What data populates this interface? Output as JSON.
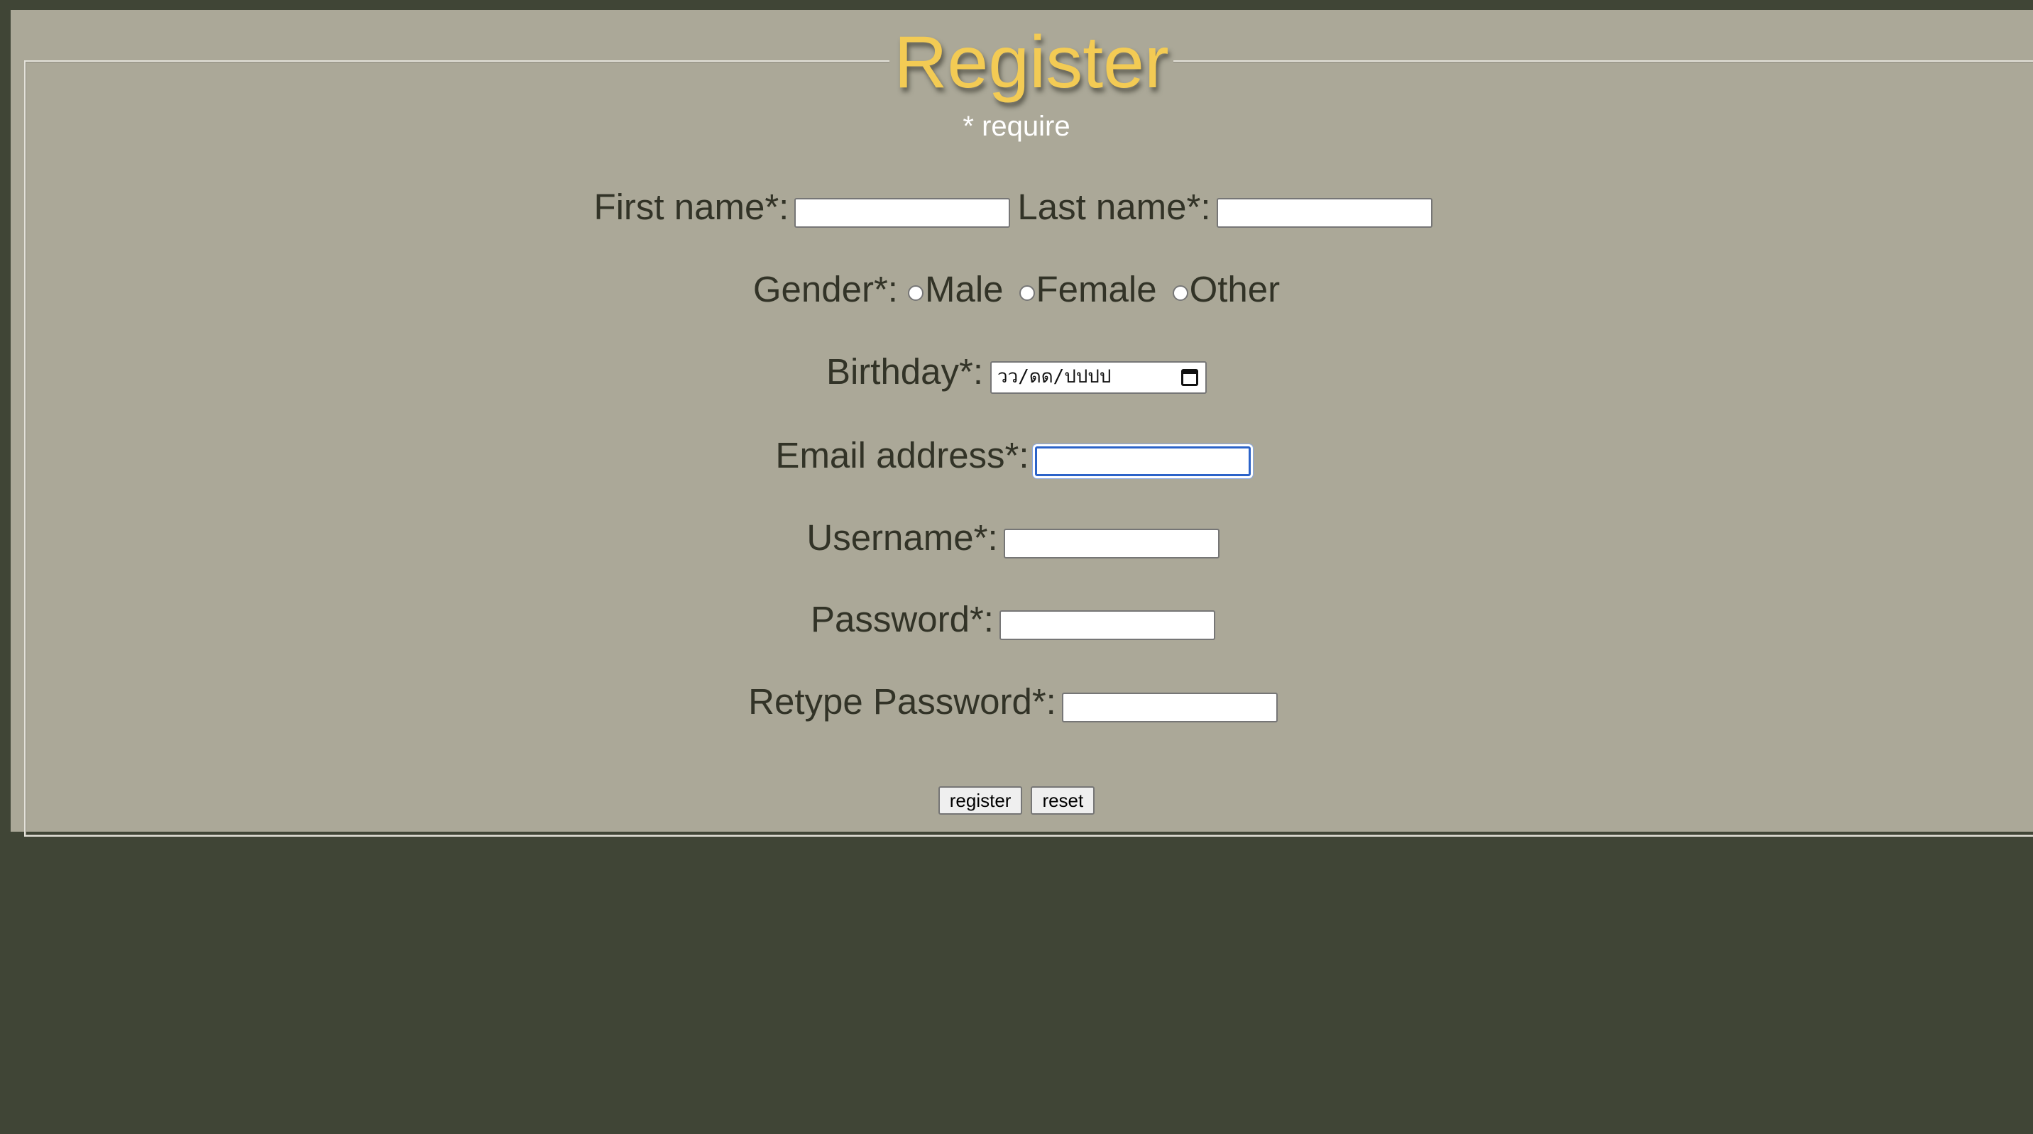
{
  "form": {
    "title": "Register",
    "require_note": "* require",
    "first_name_label": "First name*:",
    "last_name_label": "Last name*:",
    "gender_label": "Gender*:",
    "gender_options": [
      "Male",
      "Female",
      "Other"
    ],
    "birthday_label": "Birthday*:",
    "birthday_placeholder": "วว/ดด/ปปปป",
    "email_label": "Email address*:",
    "username_label": "Username*:",
    "password_label": "Password*:",
    "retype_password_label": "Retype Password*:",
    "register_button": "register",
    "reset_button": "reset"
  },
  "colors": {
    "page_background": "#404536",
    "panel_background": "#aba898",
    "title": "#f3cb54",
    "label_text": "#323327",
    "focus_ring": "#2b63c9"
  },
  "icons": {
    "date_picker": "calendar-icon"
  }
}
